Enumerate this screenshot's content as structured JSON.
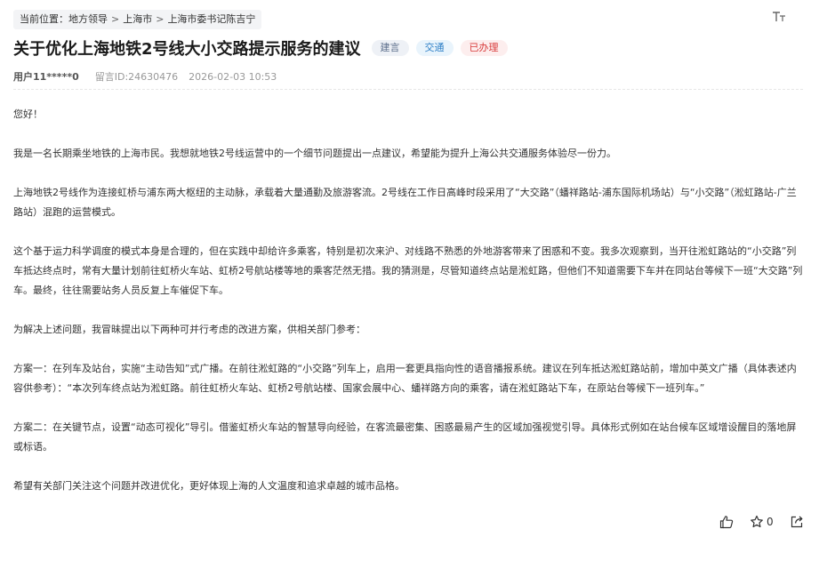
{
  "breadcrumb": {
    "prefix": "当前位置：",
    "items": [
      "地方领导",
      "上海市",
      "上海市委书记陈吉宁"
    ],
    "separator": ">"
  },
  "font_toggle": {
    "icon": "text-size-icon",
    "label": "TT"
  },
  "post": {
    "title": "关于优化上海地铁2号线大小交路提示服务的建议",
    "tags": [
      {
        "label": "建言",
        "style": "gray"
      },
      {
        "label": "交通",
        "style": "blue"
      },
      {
        "label": "已办理",
        "style": "red"
      }
    ],
    "user": "用户11*****0",
    "message_id": "留言ID:24630476",
    "datetime": "2026-02-03 10:53",
    "paragraphs": [
      "您好！",
      "我是一名长期乘坐地铁的上海市民。我想就地铁2号线运营中的一个细节问题提出一点建议，希望能为提升上海公共交通服务体验尽一份力。",
      "上海地铁2号线作为连接虹桥与浦东两大枢纽的主动脉，承载着大量通勤及旅游客流。2号线在工作日高峰时段采用了“大交路”（蟠祥路站-浦东国际机场站）与“小交路”（淞虹路站-广兰路站）混跑的运营模式。",
      "这个基于运力科学调度的模式本身是合理的，但在实践中却给许多乘客，特别是初次来沪、对线路不熟悉的外地游客带来了困惑和不变。我多次观察到，当开往淞虹路站的“小交路”列车抵达终点时，常有大量计划前往虹桥火车站、虹桥2号航站楼等地的乘客茫然无措。我的猜测是，尽管知道终点站是淞虹路，但他们不知道需要下车并在同站台等候下一班“大交路”列车。最终，往往需要站务人员反复上车催促下车。",
      "为解决上述问题，我冒昧提出以下两种可并行考虑的改进方案，供相关部门参考：",
      "方案一：在列车及站台，实施“主动告知”式广播。在前往淞虹路的“小交路”列车上，启用一套更具指向性的语音播报系统。建议在列车抵达淞虹路站前，增加中英文广播（具体表述内容供参考）：“本次列车终点站为淞虹路。前往虹桥火车站、虹桥2号航站楼、国家会展中心、蟠祥路方向的乘客，请在淞虹路站下车，在原站台等候下一班列车。”",
      "方案二：在关键节点，设置“动态可视化”导引。借鉴虹桥火车站的智慧导向经验，在客流最密集、困惑最易产生的区域加强视觉引导。具体形式例如在站台候车区域增设醒目的落地屏或标语。",
      "希望有关部门关注这个问题并改进优化，更好体现上海的人文温度和追求卓越的城市品格。"
    ]
  },
  "actions": {
    "like_icon": "thumbs-up-icon",
    "favorite_icon": "star-icon",
    "favorite_count": "0",
    "share_icon": "share-icon"
  }
}
